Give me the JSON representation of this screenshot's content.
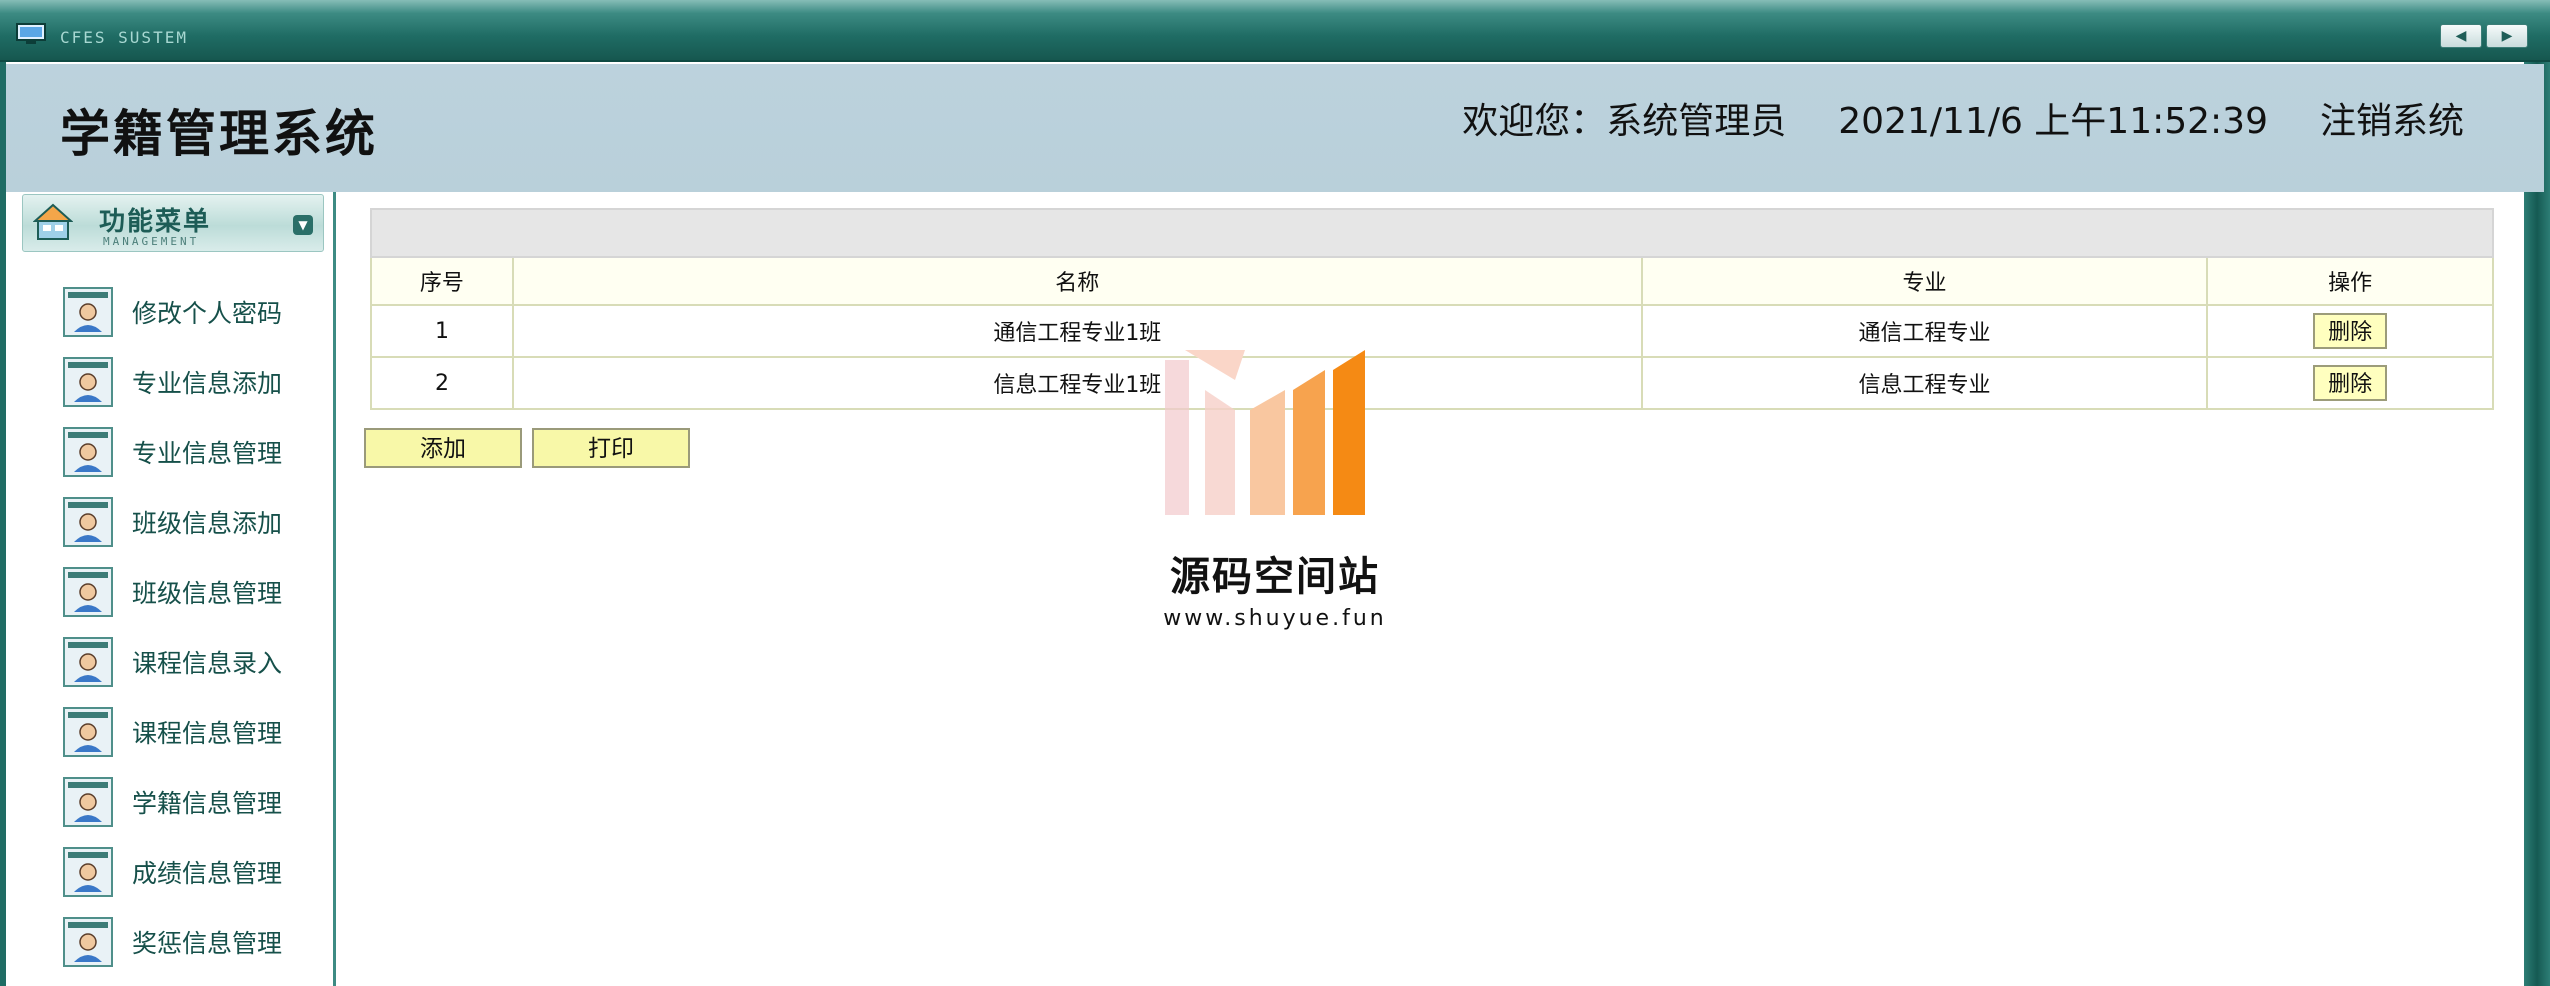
{
  "window": {
    "system_label": "CFES SUSTEM"
  },
  "header": {
    "app_title": "学籍管理系统",
    "welcome_label": "欢迎您：",
    "user_name": "系统管理员",
    "datetime": "2021/11/6 上午11:52:39",
    "logout_label": "注销系统"
  },
  "sidebar": {
    "menu_title": "功能菜单",
    "menu_subtitle": "MANAGEMENT",
    "items": [
      {
        "label": "修改个人密码"
      },
      {
        "label": "专业信息添加"
      },
      {
        "label": "专业信息管理"
      },
      {
        "label": "班级信息添加"
      },
      {
        "label": "班级信息管理"
      },
      {
        "label": "课程信息录入"
      },
      {
        "label": "课程信息管理"
      },
      {
        "label": "学籍信息管理"
      },
      {
        "label": "成绩信息管理"
      },
      {
        "label": "奖惩信息管理"
      }
    ]
  },
  "table": {
    "columns": [
      "序号",
      "名称",
      "专业",
      "操作"
    ],
    "rows": [
      {
        "index": "1",
        "name": "通信工程专业1班",
        "major": "通信工程专业",
        "action": "删除"
      },
      {
        "index": "2",
        "name": "信息工程专业1班",
        "major": "信息工程专业",
        "action": "删除"
      }
    ]
  },
  "actions": {
    "add_label": "添加",
    "print_label": "打印"
  },
  "watermark": {
    "name": "源码空间站",
    "url": "www.shuyue.fun"
  },
  "colors": {
    "titlebar": "#1f6c64",
    "header_bg": "#bcd2dd",
    "button_yellow": "#f8f8a8",
    "menu_text": "#16504a"
  },
  "icons": {
    "window": "monitor-icon",
    "menu": "home-icon",
    "collapse": "chevron-down-icon",
    "menu_item": "user-card-icon"
  }
}
